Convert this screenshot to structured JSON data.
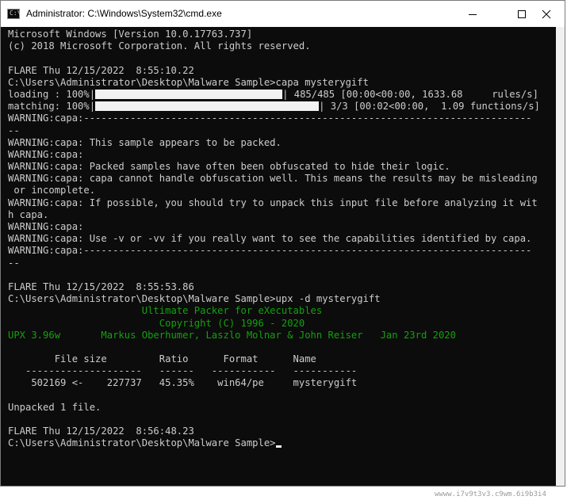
{
  "window": {
    "title": "Administrator: C:\\Windows\\System32\\cmd.exe",
    "icon": "cmd-icon",
    "icon_text": "C:\\"
  },
  "controls": {
    "minimize": "minimize-icon",
    "maximize": "maximize-icon",
    "close": "close-icon"
  },
  "console": {
    "lines": {
      "l00": "Microsoft Windows [Version 10.0.17763.737]",
      "l01": "(c) 2018 Microsoft Corporation. All rights reserved.",
      "l02": "",
      "l03": "FLARE Thu 12/15/2022  8:55:10.22",
      "l04": "C:\\Users\\Administrator\\Desktop\\Malware Sample>capa mysterygift",
      "l05a": "loading : 100%|",
      "l05b": "| 485/485 [00:00<00:00, 1633.68     rules/s]",
      "l06a": "matching: 100%|",
      "l06b": "| 3/3 [00:02<00:00,  1.09 functions/s]",
      "l07": "WARNING:capa:-----------------------------------------------------------------------------",
      "l08": "--",
      "l09": "WARNING:capa: This sample appears to be packed.",
      "l10": "WARNING:capa:",
      "l11": "WARNING:capa: Packed samples have often been obfuscated to hide their logic.",
      "l12": "WARNING:capa: capa cannot handle obfuscation well. This means the results may be misleading",
      "l13": " or incomplete.",
      "l14": "WARNING:capa: If possible, you should try to unpack this input file before analyzing it wit",
      "l15": "h capa.",
      "l16": "WARNING:capa:",
      "l17": "WARNING:capa: Use -v or -vv if you really want to see the capabilities identified by capa.",
      "l18": "WARNING:capa:-----------------------------------------------------------------------------",
      "l19": "--",
      "l20": "",
      "l21": "FLARE Thu 12/15/2022  8:55:53.86",
      "l22": "C:\\Users\\Administrator\\Desktop\\Malware Sample>upx -d mysterygift",
      "l23": "                       Ultimate Packer for eXecutables",
      "l24": "                          Copyright (C) 1996 - 2020",
      "l25": "UPX 3.96w       Markus Oberhumer, Laszlo Molnar & John Reiser   Jan 23rd 2020",
      "l26": "",
      "l27": "        File size         Ratio      Format      Name",
      "l28": "   --------------------   ------   -----------   -----------",
      "l29": "    502169 <-    227737   45.35%    win64/pe     mysterygift",
      "l30": "",
      "l31": "Unpacked 1 file.",
      "l32": "",
      "l33": "FLARE Thu 12/15/2022  8:56:48.23",
      "l34": "C:\\Users\\Administrator\\Desktop\\Malware Sample>"
    },
    "progress": {
      "loading_percent": 100,
      "matching_percent": 100
    },
    "colors": {
      "background": "#0c0c0c",
      "text": "#cccccc",
      "green": "#13a10e"
    }
  },
  "footer": {
    "partial_text": "wwww.i7v9t3v3.c9wm.6i9b3i4"
  }
}
